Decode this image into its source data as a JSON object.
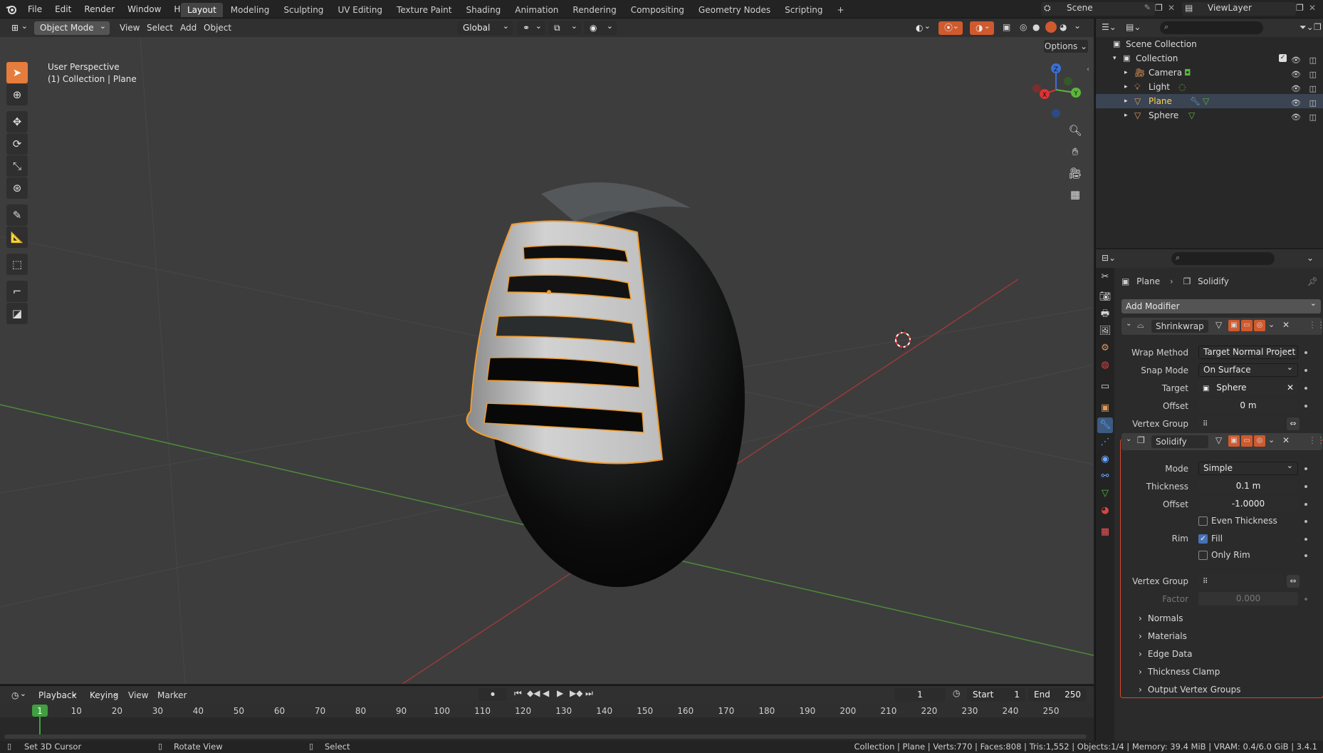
{
  "topbar": {
    "menus": [
      "File",
      "Edit",
      "Render",
      "Window",
      "Help"
    ],
    "tabs": [
      "Layout",
      "Modeling",
      "Sculpting",
      "UV Editing",
      "Texture Paint",
      "Shading",
      "Animation",
      "Rendering",
      "Compositing",
      "Geometry Nodes",
      "Scripting"
    ],
    "active_tab": "Layout",
    "scene": "Scene",
    "view_layer": "ViewLayer"
  },
  "viewport_header": {
    "mode": "Object Mode",
    "menus": [
      "View",
      "Select",
      "Add",
      "Object"
    ],
    "orientation": "Global",
    "options": "Options"
  },
  "viewport": {
    "perspective": "User Perspective",
    "context": "(1) Collection | Plane",
    "axes": {
      "x": "X",
      "y": "Y",
      "z": "Z"
    },
    "colors": {
      "bg": "#3d3d3d",
      "grid": "#484848",
      "x_axis": "#9a3a3a",
      "y_axis": "#4e8a3a",
      "outline": "#f19b2c",
      "egg_dark": "#0e0e0e",
      "cage": "#c9c9c9"
    }
  },
  "outliner": {
    "root": "Scene Collection",
    "collection": "Collection",
    "items": [
      {
        "name": "Camera",
        "icon": "camera-icon",
        "color": "#e39a5c"
      },
      {
        "name": "Light",
        "icon": "light-icon",
        "color": "#e39a5c"
      },
      {
        "name": "Plane",
        "icon": "mesh-icon",
        "color": "#e39a5c",
        "selected": true
      },
      {
        "name": "Sphere",
        "icon": "mesh-icon",
        "color": "#e39a5c"
      }
    ]
  },
  "properties": {
    "breadcrumb_object": "Plane",
    "breadcrumb_modifier": "Solidify",
    "add_modifier": "Add Modifier",
    "shrinkwrap": {
      "name": "Shrinkwrap",
      "wrap_method_label": "Wrap Method",
      "wrap_method": "Target Normal Project",
      "snap_mode_label": "Snap Mode",
      "snap_mode": "On Surface",
      "target_label": "Target",
      "target": "Sphere",
      "offset_label": "Offset",
      "offset": "0 m",
      "vertex_group_label": "Vertex Group"
    },
    "solidify": {
      "name": "Solidify",
      "mode_label": "Mode",
      "mode": "Simple",
      "thickness_label": "Thickness",
      "thickness": "0.1 m",
      "offset_label": "Offset",
      "offset": "-1.0000",
      "even_thickness": "Even Thickness",
      "rim_label": "Rim",
      "fill": "Fill",
      "only_rim": "Only Rim",
      "vertex_group_label": "Vertex Group",
      "factor_label": "Factor",
      "factor": "0.000",
      "sections": [
        "Normals",
        "Materials",
        "Edge Data",
        "Thickness Clamp",
        "Output Vertex Groups"
      ]
    }
  },
  "timeline": {
    "menus": [
      "Playback",
      "Keying",
      "View",
      "Marker"
    ],
    "current_frame": "1",
    "start_label": "Start",
    "start": "1",
    "end_label": "End",
    "end": "250",
    "ticks": [
      "1",
      "10",
      "20",
      "30",
      "40",
      "50",
      "60",
      "70",
      "80",
      "90",
      "100",
      "110",
      "120",
      "130",
      "140",
      "150",
      "160",
      "170",
      "180",
      "190",
      "200",
      "210",
      "220",
      "230",
      "240",
      "250"
    ]
  },
  "statusbar": {
    "left": "Set 3D Cursor",
    "middle": "Rotate View",
    "right_action": "Select",
    "stats": "Collection | Plane | Verts:770 | Faces:808 | Tris:1,552 | Objects:1/4 | Memory: 39.4 MiB | VRAM: 0.4/6.0 GiB | 3.4.1"
  }
}
